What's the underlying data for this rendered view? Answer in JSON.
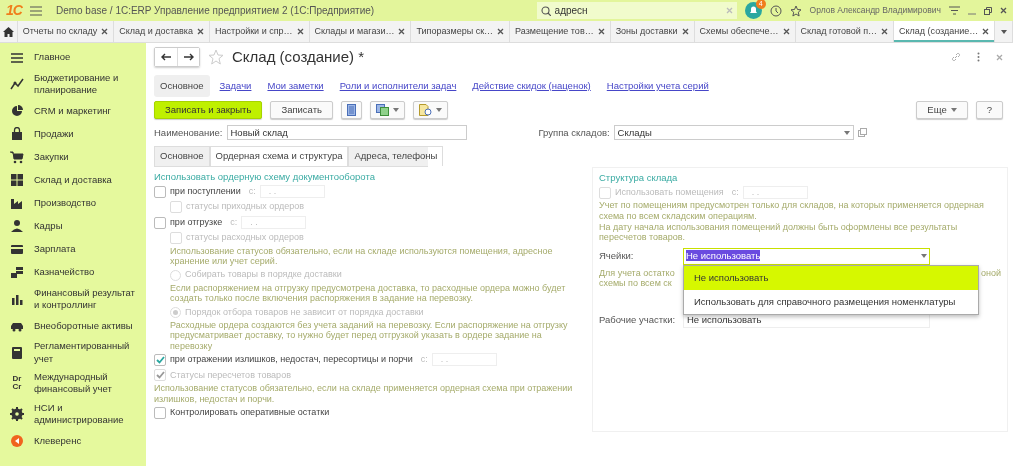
{
  "window": {
    "logo": "1С",
    "title": "Demo base / 1С:ERP Управление предприятием 2  (1С:Предприятие)"
  },
  "search": {
    "value": "адресн"
  },
  "notifications": {
    "count": "4"
  },
  "user": {
    "name": "Орлов Александр Владимирович"
  },
  "open_tabs": [
    {
      "label": "Отчеты по складу",
      "selected": false
    },
    {
      "label": "Склад и доставка",
      "selected": false
    },
    {
      "label": "Настройки и спр…",
      "selected": false
    },
    {
      "label": "Склады и магази…",
      "selected": false
    },
    {
      "label": "Типоразмеры ск…",
      "selected": false
    },
    {
      "label": "Размещение тов…",
      "selected": false
    },
    {
      "label": "Зоны доставки",
      "selected": false
    },
    {
      "label": "Схемы обеспече…",
      "selected": false
    },
    {
      "label": "Склад готовой п…",
      "selected": false
    },
    {
      "label": "Склад (создание…",
      "selected": true
    }
  ],
  "sidebar": {
    "items": [
      {
        "label": "Главное"
      },
      {
        "label": "Бюджетирование и планирование"
      },
      {
        "label": "CRM и маркетинг"
      },
      {
        "label": "Продажи"
      },
      {
        "label": "Закупки"
      },
      {
        "label": "Склад и доставка"
      },
      {
        "label": "Производство"
      },
      {
        "label": "Кадры"
      },
      {
        "label": "Зарплата"
      },
      {
        "label": "Казначейство"
      },
      {
        "label": "Финансовый результат и контроллинг"
      },
      {
        "label": "Внеоборотные активы"
      },
      {
        "label": "Регламентированный учет"
      },
      {
        "label": "Международный финансовый учет",
        "icon_text": "Dr Cr"
      },
      {
        "label": "НСИ и администрирование"
      },
      {
        "label": "Клеверенс"
      }
    ]
  },
  "form": {
    "title": "Склад (создание) *",
    "nav_links": [
      {
        "label": "Основное",
        "selected": true
      },
      {
        "label": "Задачи",
        "selected": false
      },
      {
        "label": "Мои заметки",
        "selected": false
      },
      {
        "label": "Роли и исполнители задач",
        "selected": false
      },
      {
        "label": "Действие скидок (наценок)",
        "selected": false
      },
      {
        "label": "Настройки учета серий",
        "selected": false
      }
    ],
    "toolbar": {
      "primary": "Записать и закрыть",
      "save": "Записать",
      "more": "Еще",
      "help": "?"
    },
    "name_field": {
      "label": "Наименование:",
      "value": "Новый склад"
    },
    "group_field": {
      "label": "Группа складов:",
      "value": "Склады"
    },
    "tabs": [
      {
        "label": "Основное",
        "selected": false
      },
      {
        "label": "Ордерная схема и структура",
        "selected": true
      },
      {
        "label": "Адреса, телефоны",
        "selected": false
      }
    ],
    "order_scheme": {
      "heading": "Использовать ордерную схему документооборота",
      "items": [
        {
          "kind": "checkbox",
          "label": "при поступлении",
          "checked": false,
          "disabled": false,
          "date_label": "с:",
          "date_value": ". .",
          "children": [
            {
              "kind": "checkbox",
              "label": "статусы приходных ордеров",
              "checked": false,
              "disabled": true
            }
          ]
        },
        {
          "kind": "checkbox",
          "label": "при отгрузке",
          "checked": false,
          "disabled": false,
          "date_label": "с:",
          "date_value": ". .",
          "children": [
            {
              "kind": "checkbox",
              "label": "статусы расходных ордеров",
              "checked": false,
              "disabled": true
            },
            {
              "kind": "note",
              "text": "Использование статусов обязательно, если на складе используются помещения, адресное хранение или учет серий."
            },
            {
              "kind": "radio",
              "label": "Собирать товары в порядке доставки",
              "selected": false,
              "disabled": true
            },
            {
              "kind": "note",
              "text": "Если распоряжением на отгрузку предусмотрена доставка, то расходные ордера можно будет создать только после включения распоряжения в задание на перевозку."
            },
            {
              "kind": "radio",
              "label": "Порядок отбора товаров не зависит от порядка доставки",
              "selected": true,
              "disabled": true
            },
            {
              "kind": "note",
              "text": "Расходные ордера создаются без учета заданий на перевозку. Если распоряжение на отгрузку предусматривает доставку, то нужно будет перед отгрузкой указать в ордере задание на перевозку"
            }
          ]
        },
        {
          "kind": "checkbox",
          "label": "при отражении излишков, недостач, пересортицы и порчи",
          "checked": true,
          "disabled": false,
          "date_label": "с:",
          "date_value": ". ."
        },
        {
          "kind": "checkbox",
          "label": "Статусы пересчетов товаров",
          "checked": true,
          "disabled": true
        },
        {
          "kind": "note",
          "text": "Использование статусов обязательно, если на складе применяется ордерная схема при отражении излишков, недостач и порчи."
        },
        {
          "kind": "checkbox",
          "label": "Контролировать оперативные остатки",
          "checked": false,
          "disabled": false
        }
      ]
    },
    "structure": {
      "heading": "Структура склада",
      "use_rooms": {
        "label": "Использовать помещения",
        "checked": false,
        "disabled": true,
        "date_label": "с:",
        "date_value": ". ."
      },
      "notes": [
        "Учет по помещениям предусмотрен только для складов, на которых применяется ордерная схема по всем складским операциям.",
        "На дату начала использования помещений должны быть оформлены все результаты пересчетов товаров."
      ],
      "cells": {
        "label": "Ячейки:",
        "value": "Не использовать",
        "value_selected": true,
        "options": [
          {
            "label": "Не использовать",
            "selected": true
          },
          {
            "label": "Использовать для справочного размещения номенклатуры",
            "selected": false
          }
        ]
      },
      "covered_note": {
        "left": [
          "Для учета остатко",
          "схемы по всем ск"
        ],
        "right": "оной"
      },
      "work_areas": {
        "label": "Рабочие участки:",
        "value": "Не использовать"
      }
    }
  }
}
